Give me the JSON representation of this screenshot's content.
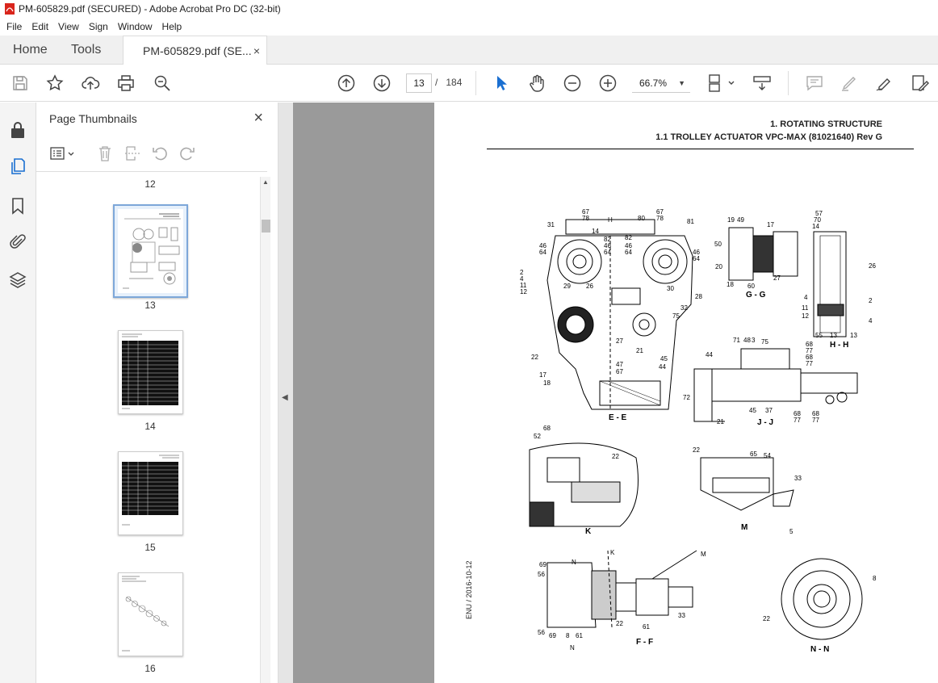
{
  "window": {
    "title": "PM-605829.pdf (SECURED) - Adobe Acrobat Pro DC (32-bit)"
  },
  "menu": [
    "File",
    "Edit",
    "View",
    "Sign",
    "Window",
    "Help"
  ],
  "tabs": {
    "home": "Home",
    "tools": "Tools",
    "document": "PM-605829.pdf (SE...",
    "close": "×"
  },
  "toolbar": {
    "current_page": "13",
    "page_separator": "/",
    "total_pages": "184",
    "zoom": "66.7%"
  },
  "thumbnails": {
    "panel_title": "Page Thumbnails",
    "close": "×",
    "pages": [
      {
        "label": "12"
      },
      {
        "label": "13",
        "selected": true
      },
      {
        "label": "14"
      },
      {
        "label": "15"
      },
      {
        "label": "16"
      }
    ]
  },
  "document": {
    "header_line1": "1. ROTATING STRUCTURE",
    "header_line2": "1.1 TROLLEY ACTUATOR VPC-MAX (81021640) Rev G",
    "footer_vertical": "ENU / 2016-10-12",
    "views": {
      "ee": "E - E",
      "gg": "G - G",
      "hh": "H - H",
      "jj": "J - J",
      "k": "K",
      "m": "M",
      "ff": "F - F",
      "nn": "N - N"
    }
  },
  "colors": {
    "accent": "#1a6fd1",
    "doc_bg": "#9a9a9a",
    "panel_bg": "#f4f4f4"
  }
}
